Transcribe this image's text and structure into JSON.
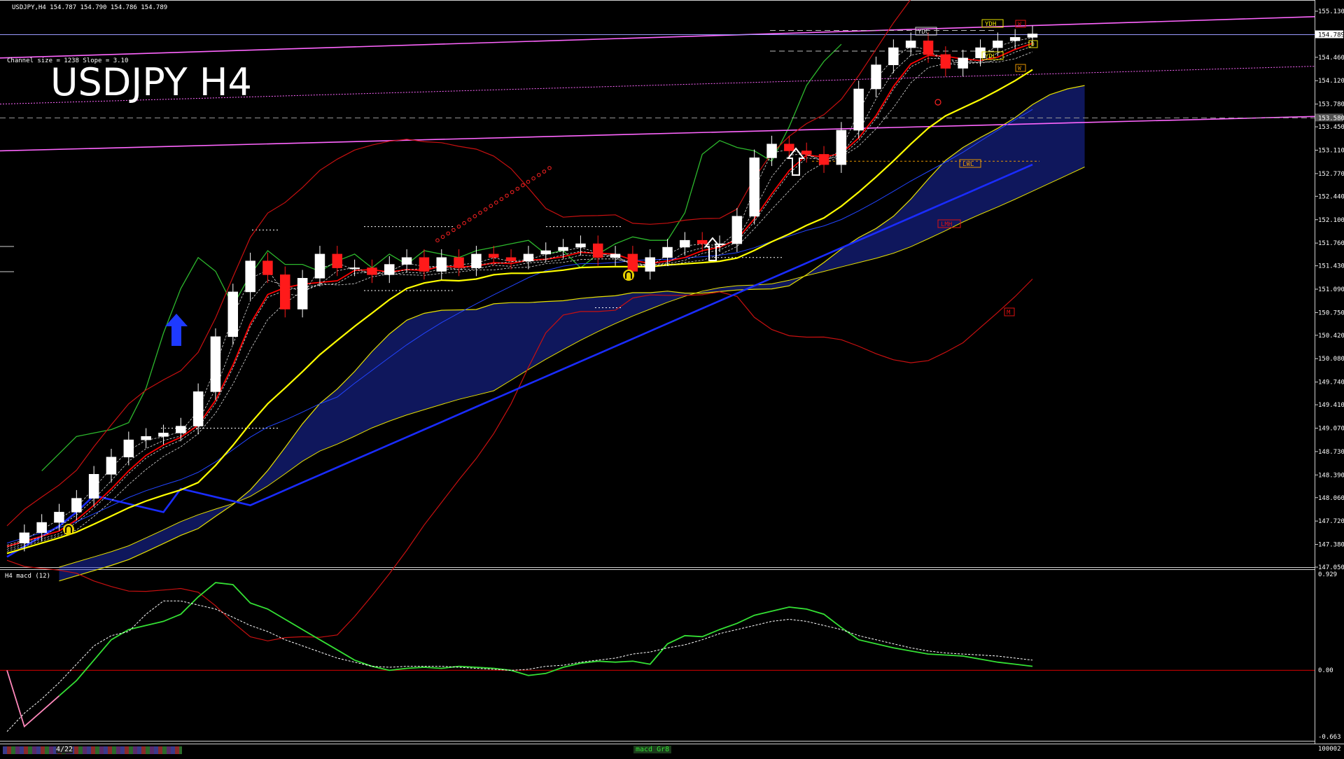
{
  "window": {
    "symbol_line": "USDJPY,H4  154.787 154.790 154.786 154.789",
    "big_title": "USDJPY H4",
    "channel_info": "Channel size = 1238 Slope = 3.10"
  },
  "colors": {
    "background": "#000000",
    "bull_candle": "#ffffff",
    "bear_candle": "#ff1a1a",
    "ma_yellow": "#ffff00",
    "ma_blue": "#1a2cff",
    "ma_red": "#ff0000",
    "bollinger": "#c81010",
    "chikou_green": "#2db82d",
    "cloud_edge": "#e6e000",
    "cloud_fill": "#2233cc",
    "channel": "#ff66ff",
    "macd_line": "#34e034",
    "macd_signal": "#ffffff",
    "macd_zero": "#b00000",
    "pink_segment": "#ff88bb"
  },
  "price_axis": {
    "ticks": [
      "155.130",
      "154.789",
      "154.460",
      "154.120",
      "153.780",
      "153.580",
      "153.450",
      "153.110",
      "152.770",
      "152.440",
      "152.100",
      "151.760",
      "151.430",
      "151.090",
      "150.750",
      "150.420",
      "150.080",
      "149.740",
      "149.410",
      "149.070",
      "148.730",
      "148.390",
      "148.060",
      "147.720",
      "147.380",
      "147.050"
    ],
    "current_price": "154.789",
    "marked_price": "153.580"
  },
  "level_labels": {
    "ydc": "YDC",
    "ydh": "YDH",
    "ydl": "YDL",
    "lwl": "LWL",
    "lmh": "LMH",
    "m": "M",
    "w": "W",
    "d": "D"
  },
  "macd_panel": {
    "title": "H4 macd (12)",
    "top_value": "0.929",
    "zero_value": "0.00",
    "bottom_value": "-0.663"
  },
  "bottom_bar": {
    "date_label": "4/22",
    "tab_label": "macd Gr8",
    "right_value": "100002"
  },
  "chart_data": {
    "type": "line",
    "title": "USDJPY H4",
    "ylim": [
      147.05,
      155.13
    ],
    "indicator_ylim": [
      -0.663,
      0.929
    ],
    "series": [
      {
        "values": [
          147.4,
          147.55,
          147.7,
          147.85,
          148.05,
          148.4,
          148.65,
          148.9,
          148.95,
          149.0,
          149.1,
          149.6,
          150.4,
          151.05,
          151.5,
          151.3,
          150.8,
          151.25,
          151.6,
          151.4,
          151.4,
          151.3,
          151.45,
          151.55,
          151.35,
          151.55,
          151.4,
          151.6,
          151.55,
          151.5,
          151.6,
          151.65,
          151.7,
          151.75,
          151.55,
          151.6,
          151.35,
          151.55,
          151.7,
          151.8,
          151.75,
          151.75,
          152.15,
          153.0,
          153.2,
          153.1,
          153.05,
          152.9,
          153.4,
          154.0,
          154.35,
          154.6,
          154.7,
          154.5,
          154.3,
          154.45,
          154.6,
          154.7,
          154.75,
          154.8
        ]
      },
      {
        "values": [
          0.0,
          -0.55,
          -0.4,
          -0.25,
          -0.1,
          0.1,
          0.3,
          0.4,
          0.44,
          0.48,
          0.55,
          0.72,
          0.86,
          0.84,
          0.66,
          0.6,
          0.5,
          0.4,
          0.3,
          0.2,
          0.1,
          0.04,
          0.0,
          0.02,
          0.03,
          0.02,
          0.04,
          0.03,
          0.02,
          0.0,
          -0.05,
          -0.03,
          0.03,
          0.07,
          0.09,
          0.08,
          0.09,
          0.06,
          0.26,
          0.34,
          0.33,
          0.4,
          0.46,
          0.54,
          0.58,
          0.62,
          0.6,
          0.55,
          0.42,
          0.3,
          0.26,
          0.22,
          0.19,
          0.16,
          0.15,
          0.14,
          0.11,
          0.08,
          0.06,
          0.04
        ]
      },
      {
        "values": [
          -0.6,
          -0.42,
          -0.28,
          -0.12,
          0.06,
          0.24,
          0.34,
          0.38,
          0.55,
          0.68,
          0.68,
          0.64,
          0.6,
          0.52,
          0.44,
          0.38,
          0.3,
          0.24,
          0.18,
          0.12,
          0.08,
          0.04,
          0.03,
          0.04,
          0.04,
          0.04,
          0.03,
          0.02,
          0.01,
          0.0,
          0.01,
          0.04,
          0.05,
          0.08,
          0.1,
          0.12,
          0.16,
          0.18,
          0.22,
          0.25,
          0.3,
          0.36,
          0.4,
          0.44,
          0.48,
          0.5,
          0.48,
          0.44,
          0.4,
          0.34,
          0.3,
          0.26,
          0.22,
          0.19,
          0.17,
          0.16,
          0.15,
          0.14,
          0.12,
          0.1
        ]
      }
    ]
  }
}
